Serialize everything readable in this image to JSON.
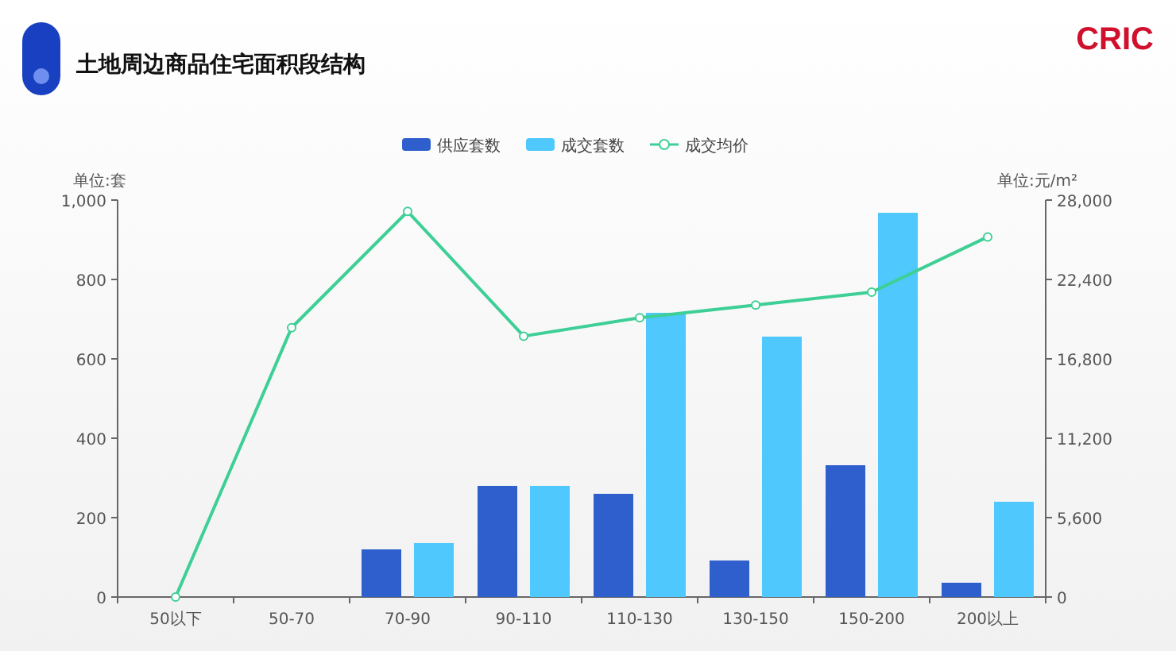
{
  "header": {
    "title": "土地周边商品住宅面积段结构",
    "brand": "CRIC"
  },
  "chart": {
    "chart_data": {
      "type": "bar",
      "categories": [
        "50以下",
        "50-70",
        "70-90",
        "90-110",
        "110-130",
        "130-150",
        "150-200",
        "200以上"
      ],
      "ylabel": "单位:套",
      "y2label": "单位:元/m²",
      "ylim": [
        0,
        1000
      ],
      "yticks": [
        {
          "value": 0,
          "label": "0"
        },
        {
          "value": 200,
          "label": "200"
        },
        {
          "value": 400,
          "label": "400"
        },
        {
          "value": 600,
          "label": "600"
        },
        {
          "value": 800,
          "label": "800"
        },
        {
          "value": 1000,
          "label": "1,000"
        }
      ],
      "y2lim": [
        0,
        28000
      ],
      "y2ticks": [
        {
          "value": 0,
          "label": "0"
        },
        {
          "value": 5600,
          "label": "5,600"
        },
        {
          "value": 11200,
          "label": "11,200"
        },
        {
          "value": 16800,
          "label": "16,800"
        },
        {
          "value": 22400,
          "label": "22,400"
        },
        {
          "value": 28000,
          "label": "28,000"
        }
      ],
      "series": [
        {
          "name": "供应套数",
          "color": "#2f5fcc",
          "values": [
            0,
            0,
            120,
            280,
            260,
            92,
            332,
            36
          ]
        },
        {
          "name": "成交套数",
          "color": "#4fc8fd",
          "values": [
            0,
            0,
            136,
            280,
            716,
            656,
            968,
            240
          ]
        },
        {
          "name": "成交均价",
          "color": "#3ecf96",
          "type": "line",
          "axis": "y2",
          "marker": "circle",
          "values": [
            0,
            19000,
            27200,
            18400,
            19700,
            20600,
            21500,
            25400
          ]
        }
      ],
      "stacked": false,
      "legend": "top"
    }
  }
}
